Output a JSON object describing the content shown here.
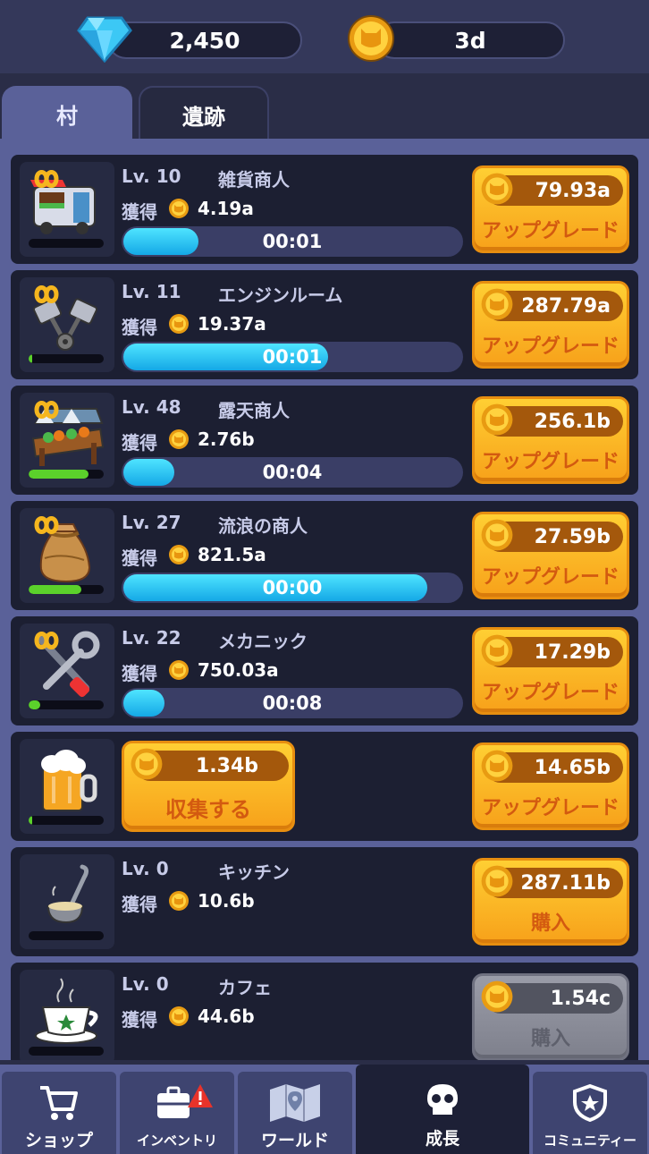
{
  "resources": {
    "gems": "2,450",
    "coins": "3d"
  },
  "tabs": {
    "village": "村",
    "ruins": "遺跡"
  },
  "labels": {
    "earn": "獲得",
    "upgrade": "アップグレード",
    "buy": "購入",
    "collect": "収集する"
  },
  "buildings": [
    {
      "level": "Lv. 10",
      "name": "雑貨商人",
      "earn": "4.19a",
      "timer": "00:01",
      "cost": "79.93a",
      "timer_progress": 0.22,
      "level_progress": 0.0,
      "icon": "shop-van-icon"
    },
    {
      "level": "Lv. 11",
      "name": "エンジンルーム",
      "earn": "19.37a",
      "timer": "00:01",
      "cost": "287.79a",
      "timer_progress": 0.6,
      "level_progress": 0.05,
      "icon": "engine-pistons-icon"
    },
    {
      "level": "Lv. 48",
      "name": "露天商人",
      "earn": "2.76b",
      "timer": "00:04",
      "cost": "256.1b",
      "timer_progress": 0.15,
      "level_progress": 0.8,
      "icon": "market-stall-icon"
    },
    {
      "level": "Lv. 27",
      "name": "流浪の商人",
      "earn": "821.5a",
      "timer": "00:00",
      "cost": "27.59b",
      "timer_progress": 0.89,
      "level_progress": 0.7,
      "icon": "sack-icon"
    },
    {
      "level": "Lv. 22",
      "name": "メカニック",
      "earn": "750.03a",
      "timer": "00:08",
      "cost": "17.29b",
      "timer_progress": 0.12,
      "level_progress": 0.15,
      "icon": "wrench-screwdriver-icon"
    },
    {
      "collect_amount": "1.34b",
      "cost": "14.65b",
      "level_progress": 0.05,
      "icon": "beer-mug-icon"
    },
    {
      "level": "Lv. 0",
      "name": "キッチン",
      "earn": "10.6b",
      "cost": "287.11b",
      "icon": "ladle-icon"
    },
    {
      "level": "Lv. 0",
      "name": "カフェ",
      "earn": "44.6b",
      "cost": "1.54c",
      "icon": "coffee-cup-icon"
    }
  ],
  "nav": {
    "shop": "ショップ",
    "inventory": "インベントリ",
    "world": "ワールド",
    "growth": "成長",
    "community": "コミュニティー"
  },
  "colors": {
    "accent": "#5a6199",
    "button": "#f7a11a",
    "progress": "#14a8e6",
    "level_bar": "#5bd12b",
    "alert": "#e8332a"
  }
}
